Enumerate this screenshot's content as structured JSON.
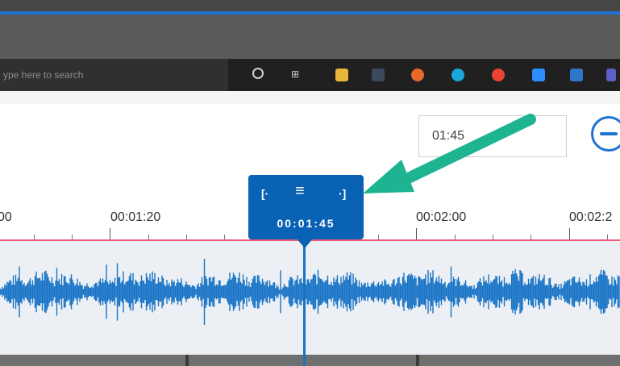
{
  "taskbar": {
    "search_placeholder": "ype here to search",
    "apps": [
      {
        "name": "file-explorer-icon",
        "color": "#e7b73b"
      },
      {
        "name": "calculator-icon",
        "color": "#3a4a5a"
      },
      {
        "name": "firefox-icon",
        "color": "#e86a2a"
      },
      {
        "name": "edge-icon",
        "color": "#1aa8d8"
      },
      {
        "name": "chrome-icon",
        "color": "#ea4335"
      },
      {
        "name": "zoom-icon",
        "color": "#2d8cff"
      },
      {
        "name": "remote-desktop-icon",
        "color": "#2e77c8"
      },
      {
        "name": "teams-icon",
        "color": "#5b5fc7"
      }
    ]
  },
  "toolbar": {
    "time_value": "01:45",
    "zoom_out_icon": "minus-circle-icon"
  },
  "timeline": {
    "ticks": [
      "00",
      "00:01:20",
      "00:02:00",
      "00:02:2"
    ]
  },
  "playhead": {
    "time": "00:01:45",
    "icons": {
      "mark_in": "[·",
      "menu": "≡",
      "mark_out": "·]"
    }
  },
  "colors": {
    "accent": "#0a62b5",
    "waveform": "#1873c6",
    "ruler_line": "#f0567a",
    "arrow": "#1fb491"
  }
}
